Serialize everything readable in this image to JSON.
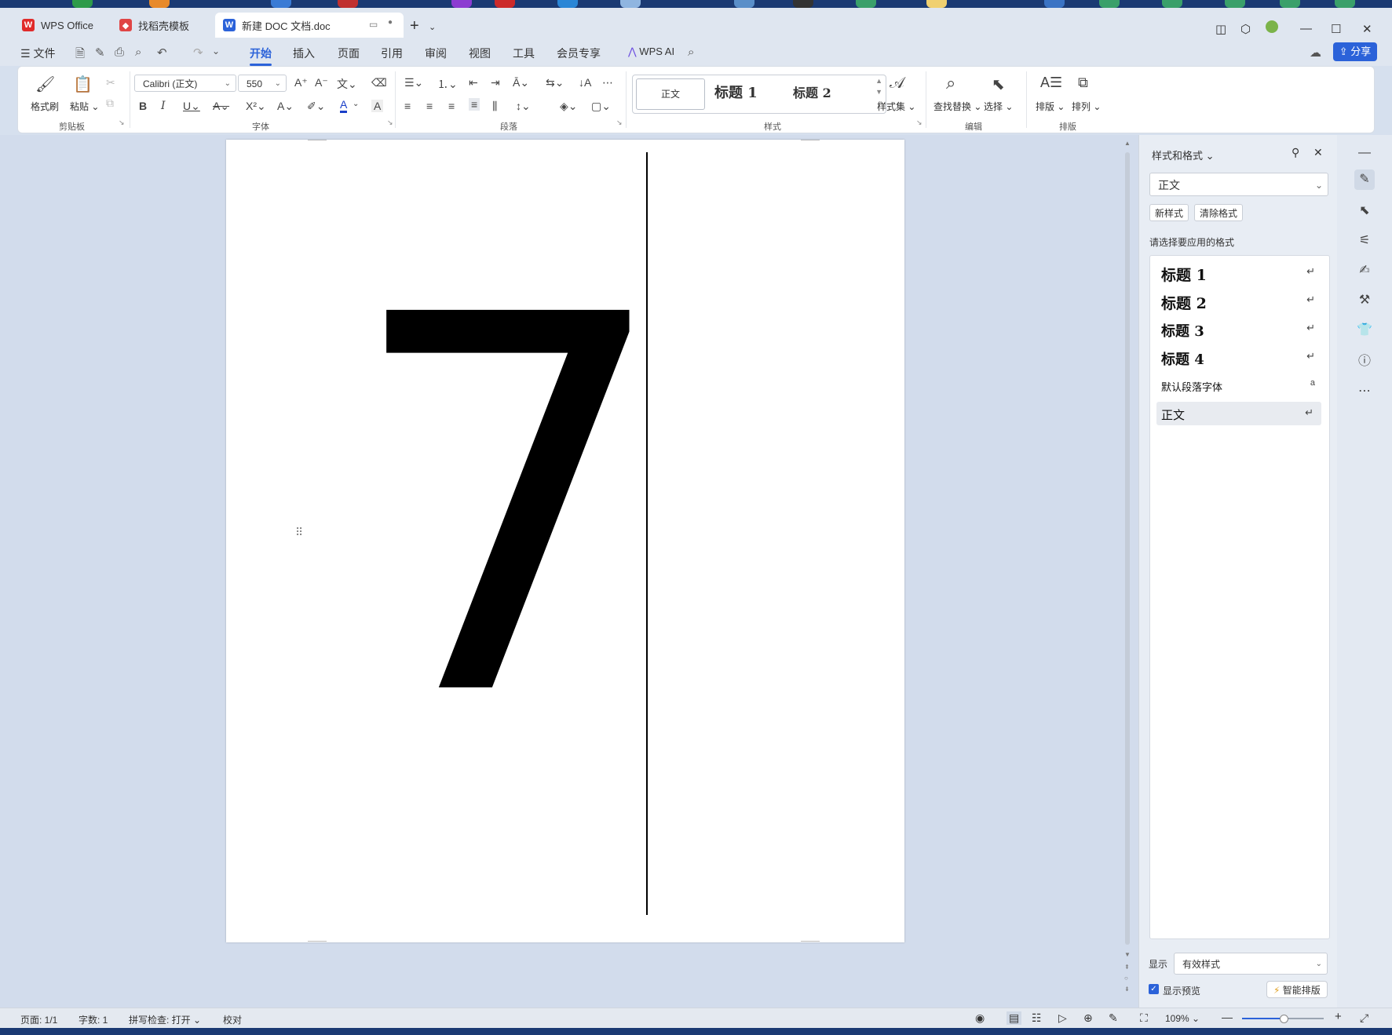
{
  "tabs": [
    {
      "label": "WPS Office",
      "icon": "wps-logo-icon"
    },
    {
      "label": "找稻壳模板",
      "icon": "docer-icon"
    },
    {
      "label": "新建 DOC 文档.doc",
      "icon": "word-doc-icon",
      "active": true
    }
  ],
  "menu": {
    "file": "文件",
    "items": [
      "开始",
      "插入",
      "页面",
      "引用",
      "审阅",
      "视图",
      "工具",
      "会员专享"
    ],
    "active": "开始",
    "wps_ai": "WPS AI",
    "share": "分享"
  },
  "ribbon": {
    "clipboard": {
      "format_painter": "格式刷",
      "paste": "粘贴",
      "group": "剪贴板"
    },
    "font": {
      "name": "Calibri (正文)",
      "size": "550",
      "group": "字体"
    },
    "paragraph": {
      "group": "段落"
    },
    "styles": {
      "normal": "正文",
      "heading1": "标题 1",
      "heading2": "标题 2",
      "style_set": "样式集",
      "group": "样式"
    },
    "edit": {
      "find_replace": "查找替换",
      "select": "选择",
      "group": "编辑"
    },
    "layout": {
      "typeset": "排版",
      "arrange": "排列",
      "group": "排版"
    }
  },
  "document": {
    "content": "7"
  },
  "side_panel": {
    "title": "样式和格式",
    "current_style": "正文",
    "new_style": "新样式",
    "clear_format": "清除格式",
    "prompt": "请选择要应用的格式",
    "styles": [
      {
        "label": "标题 1",
        "kind": "heading"
      },
      {
        "label": "标题 2",
        "kind": "heading"
      },
      {
        "label": "标题 3",
        "kind": "heading"
      },
      {
        "label": "标题 4",
        "kind": "heading"
      },
      {
        "label": "默认段落字体",
        "kind": "char"
      },
      {
        "label": "正文",
        "kind": "para",
        "selected": true
      }
    ],
    "show_label": "显示",
    "show_value": "有效样式",
    "preview_label": "显示预览",
    "smart_typeset": "智能排版"
  },
  "status": {
    "page": "页面: 1/1",
    "words": "字数: 1",
    "spell": "拼写检查: 打开",
    "proof": "校对",
    "zoom": "109%"
  },
  "colors": {
    "accent": "#2b62d9",
    "workspace": "#d2dcec",
    "chrome": "#dfe6f0"
  }
}
